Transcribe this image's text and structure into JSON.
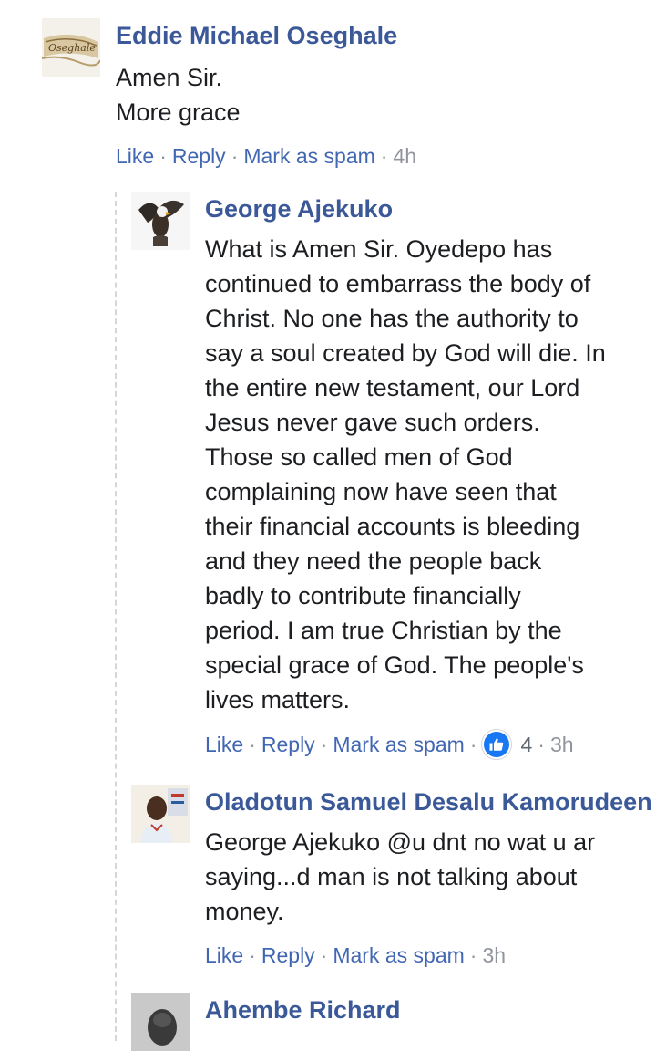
{
  "comments": [
    {
      "author": "Eddie Michael Oseghale",
      "avatar_text": "Oseghale",
      "lines": [
        "Amen Sir.",
        "More grace"
      ],
      "actions": {
        "like": "Like",
        "reply": "Reply",
        "spam": "Mark as spam",
        "time": "4h"
      }
    },
    {
      "author": "George Ajekuko",
      "lines": [
        "What is Amen Sir. Oyedepo has",
        "continued to embarrass the body of",
        "Christ. No one has the authority to",
        "say a soul created by God will die. In",
        "the entire new testament, our Lord",
        "Jesus never gave such orders.",
        "Those so called men of God",
        "complaining now have seen that",
        "their financial accounts is bleeding",
        "and they need the people back",
        "badly to contribute financially",
        "period. I am true Christian by the",
        "special grace of God. The people's",
        "lives matters."
      ],
      "actions": {
        "like": "Like",
        "reply": "Reply",
        "spam": "Mark as spam",
        "reaction_count": "4",
        "time": "3h"
      }
    },
    {
      "author": "Oladotun Samuel Desalu Kamorudeen",
      "lines": [
        "George Ajekuko @u dnt no wat u ar",
        "saying...d man is not talking about",
        "money."
      ],
      "actions": {
        "like": "Like",
        "reply": "Reply",
        "spam": "Mark as spam",
        "time": "3h"
      }
    },
    {
      "author": "Ahembe Richard"
    }
  ],
  "separator": "·",
  "colors": {
    "author": "#3b5998",
    "action_link": "#4267b2",
    "meta": "#90949c",
    "like_badge": "#1877f2"
  }
}
